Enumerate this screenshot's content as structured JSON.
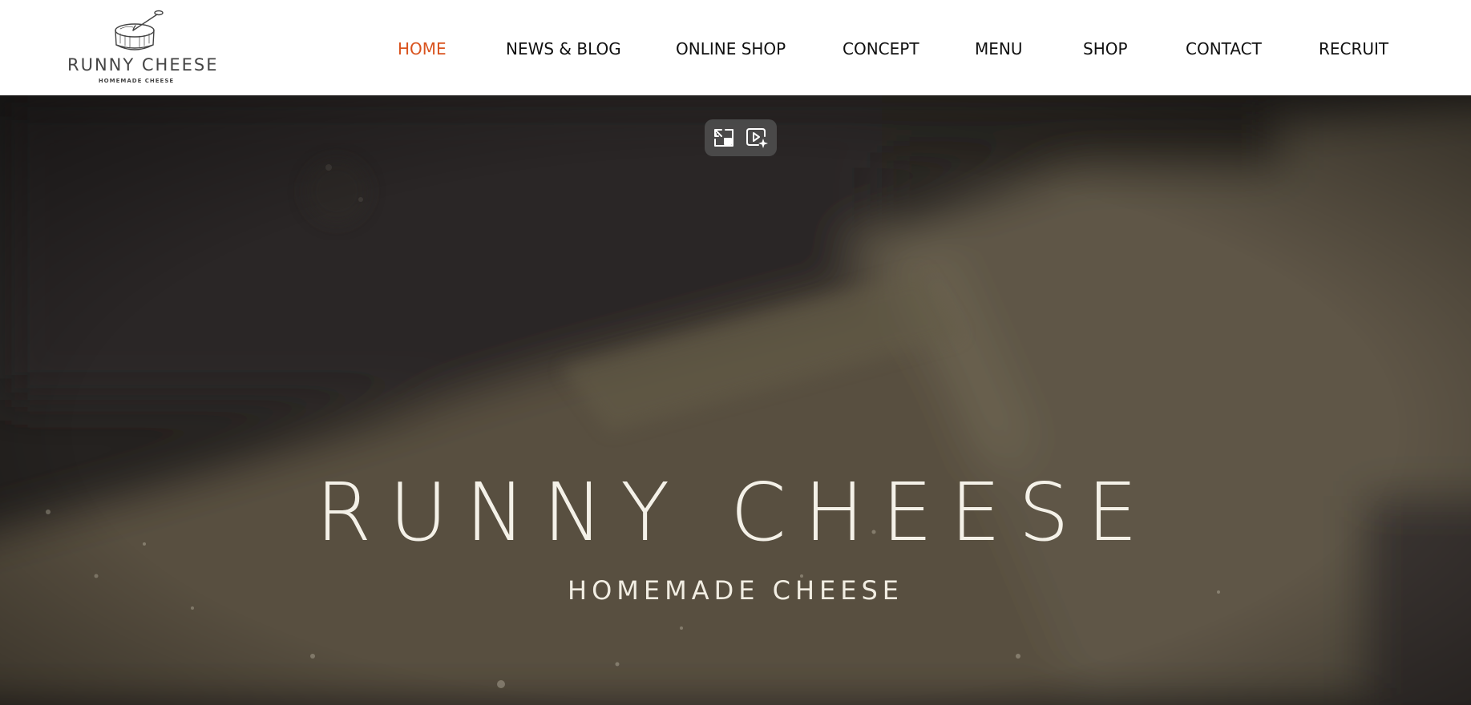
{
  "brand": {
    "name": "RUNNY CHEESE",
    "tagline": "HOMEMADE CHEESE"
  },
  "nav": {
    "items": [
      {
        "label": "HOME",
        "active": true
      },
      {
        "label": "NEWS & BLOG",
        "active": false
      },
      {
        "label": "ONLINE SHOP",
        "active": false
      },
      {
        "label": "CONCEPT",
        "active": false
      },
      {
        "label": "MENU",
        "active": false
      },
      {
        "label": "SHOP",
        "active": false
      },
      {
        "label": "CONTACT",
        "active": false
      },
      {
        "label": "RECRUIT",
        "active": false
      }
    ]
  },
  "hero": {
    "title": "RUNNY CHEESE",
    "subtitle": "HOMEMADE CHEESE"
  },
  "video_controls": {
    "buttons": [
      "exit-picture-in-picture-icon",
      "video-effects-icon"
    ]
  },
  "colors": {
    "accent": "#d9531e",
    "nav_text": "#111111",
    "header_bg": "#ffffff",
    "hero_text": "#f4f1e8"
  }
}
